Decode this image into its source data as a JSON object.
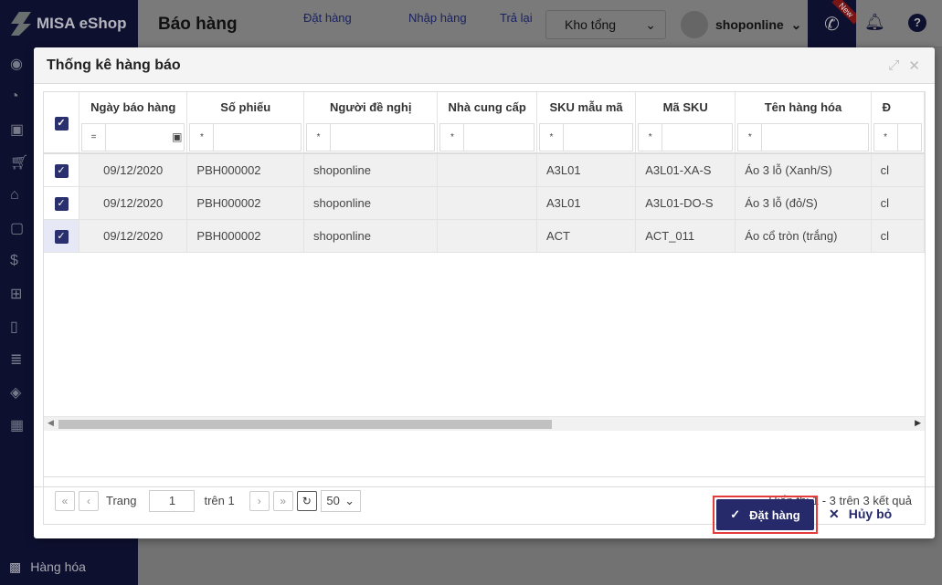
{
  "app": {
    "brand": "MISA eShop",
    "page_title": "Báo hàng",
    "nav": [
      "Đặt hàng",
      "Nhập hàng",
      "Trả lại"
    ],
    "store": "Kho tổng",
    "user": "shoponline",
    "new_badge": "New",
    "sidebar_bottom": "Hàng hóa"
  },
  "modal": {
    "title": "Thống kê hàng báo",
    "columns": [
      "Ngày báo hàng",
      "Số phiếu",
      "Người đề nghị",
      "Nhà cung cấp",
      "SKU mẫu mã",
      "Mã SKU",
      "Tên hàng hóa",
      "Đ"
    ],
    "filter_ops": [
      "=",
      "*",
      "*",
      "*",
      "*",
      "*",
      "*",
      "*"
    ],
    "rows": [
      [
        "09/12/2020",
        "PBH000002",
        "shoponline",
        "",
        "A3L01",
        "A3L01-XA-S",
        "Áo 3 lỗ (Xanh/S)",
        "cl"
      ],
      [
        "09/12/2020",
        "PBH000002",
        "shoponline",
        "",
        "A3L01",
        "A3L01-DO-S",
        "Áo 3 lỗ (đỏ/S)",
        "cl"
      ],
      [
        "09/12/2020",
        "PBH000002",
        "shoponline",
        "",
        "ACT",
        "ACT_011",
        "Áo cổ tròn (trắng)",
        "cl"
      ]
    ],
    "pager": {
      "page_label": "Trang",
      "page": "1",
      "of_label": "trên 1",
      "page_size": "50",
      "info": "Hiển thị 1 - 3 trên 3 kết quả"
    },
    "order_button": "Đặt hàng",
    "cancel_button": "Hủy bỏ"
  }
}
